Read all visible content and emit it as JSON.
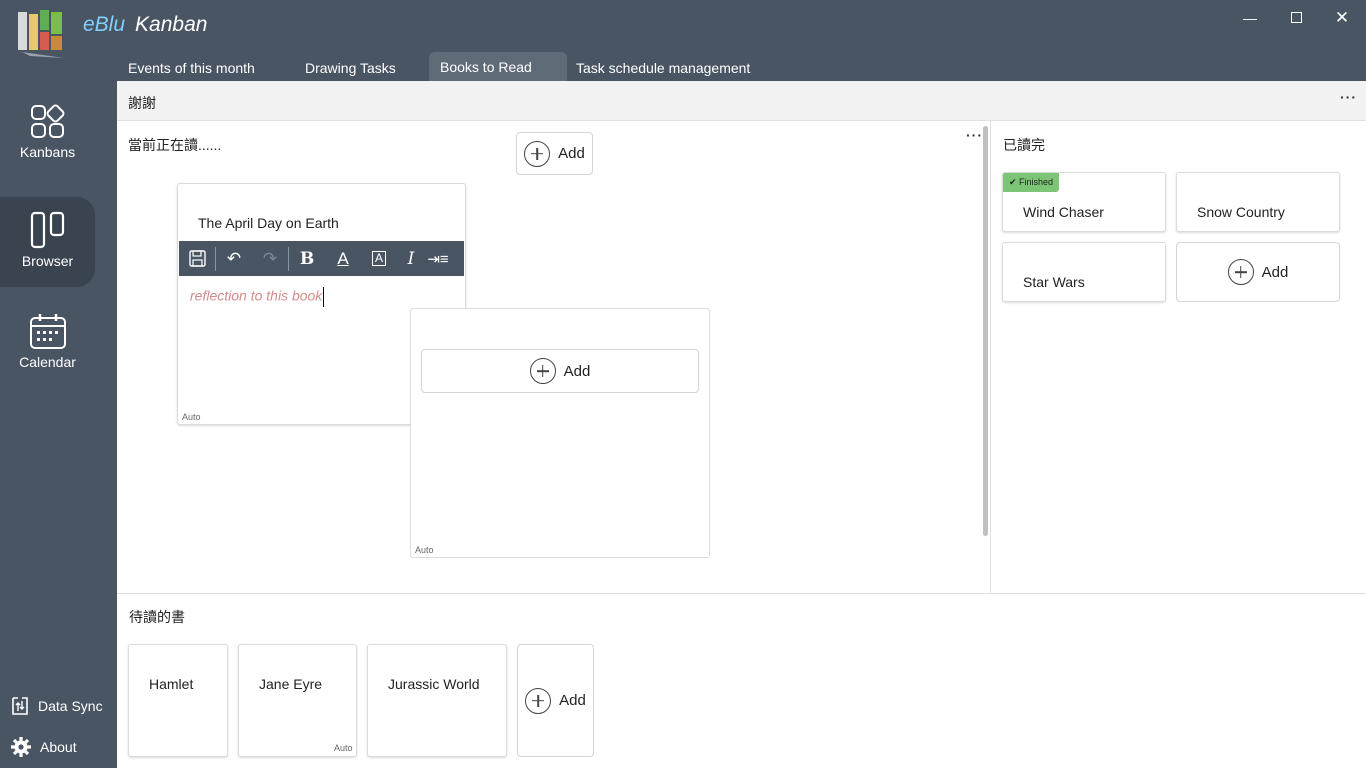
{
  "app": {
    "brand": "eBlu",
    "name": "Kanban"
  },
  "tabs": [
    {
      "label": "Events of this month"
    },
    {
      "label": "Drawing Tasks"
    },
    {
      "label": "Books to Read",
      "active": true
    },
    {
      "label": "Task schedule management"
    }
  ],
  "nav": {
    "items": [
      {
        "label": "Kanbans",
        "icon": "kanbans-icon"
      },
      {
        "label": "Browser",
        "icon": "browser-icon",
        "active": true
      },
      {
        "label": "Calendar",
        "icon": "calendar-icon"
      }
    ],
    "data_sync": "Data Sync",
    "about": "About"
  },
  "board": {
    "title": "謝謝"
  },
  "reading": {
    "title": "當前正在讀......",
    "add_label": "Add",
    "open_card": {
      "title": "The April Day on Earth",
      "placeholder": "reflection to this book",
      "auto_label": "Auto"
    },
    "drop_card": {
      "add_label": "Add",
      "auto_label": "Auto"
    }
  },
  "finished": {
    "title": "已讀完",
    "badge": "Finished",
    "cards": [
      "Wind Chaser",
      "Snow Country",
      "Star Wars"
    ],
    "add_label": "Add"
  },
  "to_read": {
    "title": "待讀的書",
    "cards": [
      "Hamlet",
      "Jane Eyre",
      "Jurassic World"
    ],
    "auto_label": "Auto",
    "add_label": "Add"
  },
  "colors": {
    "sidebar": "#4a5563",
    "accent": "#7fd0ff",
    "badge": "#7cc576",
    "placeholder": "#d48a8a"
  }
}
